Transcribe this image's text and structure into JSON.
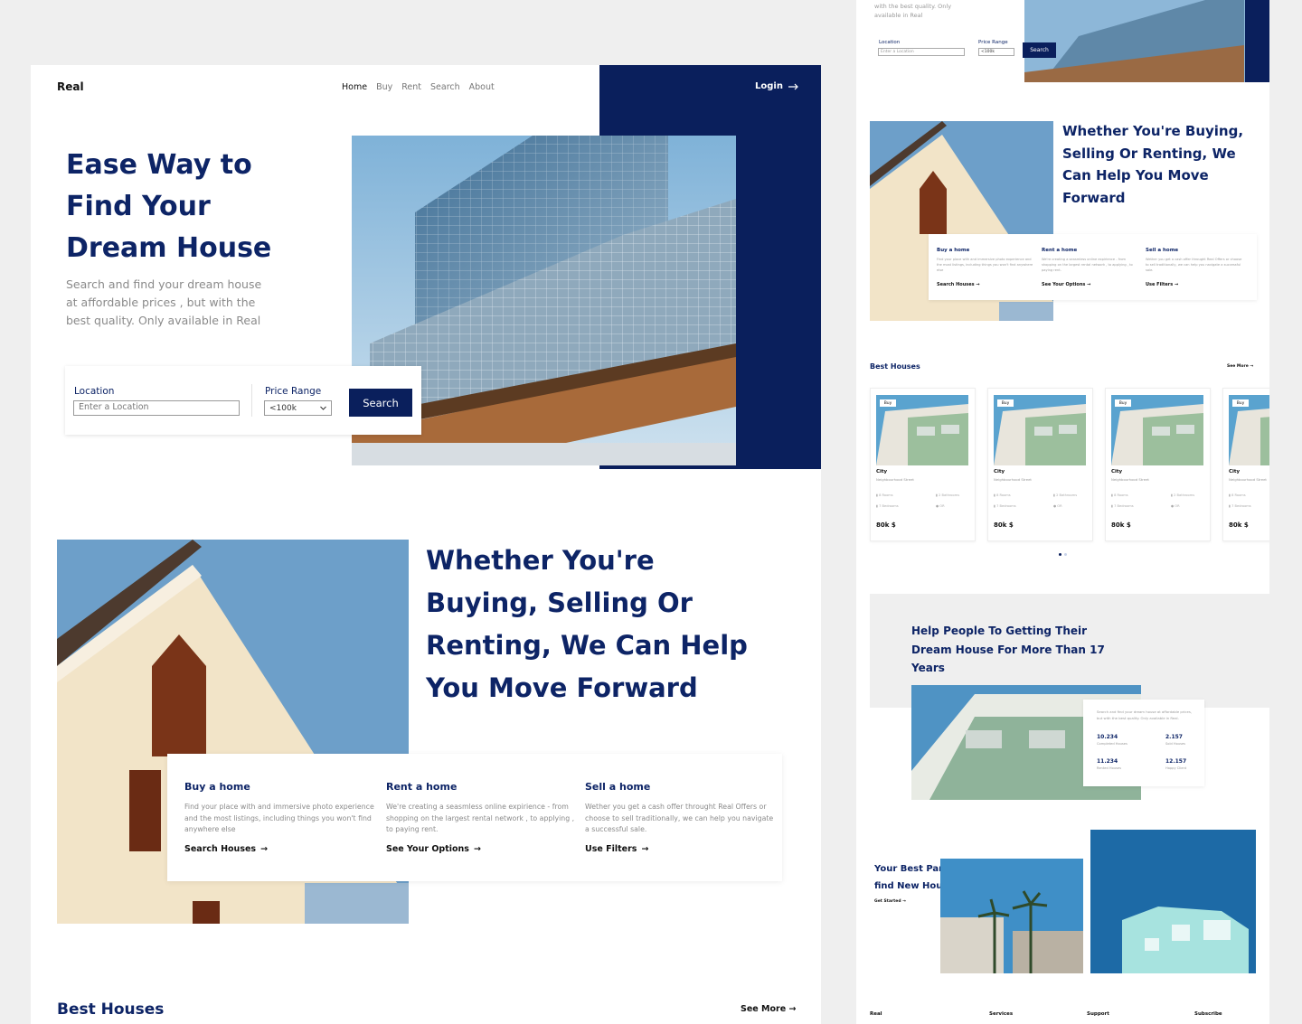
{
  "brand": "Real",
  "nav": {
    "items": [
      "Home",
      "Buy",
      "Rent",
      "Search",
      "About"
    ],
    "active": "Home",
    "login": "Login"
  },
  "hero": {
    "title_lines": [
      "Ease Way to",
      "Find Your",
      "Dream House"
    ],
    "description": "Search and find your dream house at affordable prices , but with the best quality. Only available in Real",
    "location_label": "Location",
    "location_placeholder": "Enter a Location",
    "price_label": "Price Range",
    "price_value": "<100k",
    "search_button": "Search"
  },
  "section2": {
    "title": "Whether You're Buying, Selling Or Renting, We Can Help You Move Forward",
    "services": [
      {
        "title": "Buy a home",
        "text": "Find your place with and immersive photo experience and the most listings, including things you won't find anywhere else",
        "link": "Search Houses"
      },
      {
        "title": "Rent a home",
        "text": "We're creating a seasmless online expirience - from shopping on the largest rental network , to applying , to paying rent.",
        "link": "See Your Options"
      },
      {
        "title": "Sell a home",
        "text": "Wether you get a cash offer throught Real Offers or choose to sell traditionally, we can help you navigate a successful sale.",
        "link": "Use Filters"
      }
    ]
  },
  "best": {
    "title": "Best Houses",
    "see_more": "See More"
  },
  "right": {
    "hero_desc": "with the best quality. Only available in Real",
    "card": {
      "tag": "Buy",
      "city": "City",
      "street": "Neighbourhood Street",
      "rooms": "8 Rooms",
      "baths": "2 Bathrooms",
      "beds": "7 Bedrooms",
      "loc": "OR",
      "price": "80k $"
    },
    "help_title": "Help People To Getting Their Dream House For More Than 17 Years",
    "help_desc": "Search and find your dream house at affordable prices, but with the best quality. Only available in Real.",
    "stats": [
      {
        "value": "10.234",
        "label": "Completed Houses"
      },
      {
        "value": "2.157",
        "label": "Sold Houses"
      },
      {
        "value": "11.234",
        "label": "Rented Houses"
      },
      {
        "value": "12.157",
        "label": "Happy Client"
      }
    ],
    "partner_title": "Your Best Partner To find New House",
    "get_started": "Get Started",
    "footer": [
      "Real",
      "Services",
      "Support",
      "Subscribe"
    ]
  },
  "colors": {
    "navy": "#0a1f5c",
    "ink": "#0d2466",
    "bg": "#efefef"
  }
}
